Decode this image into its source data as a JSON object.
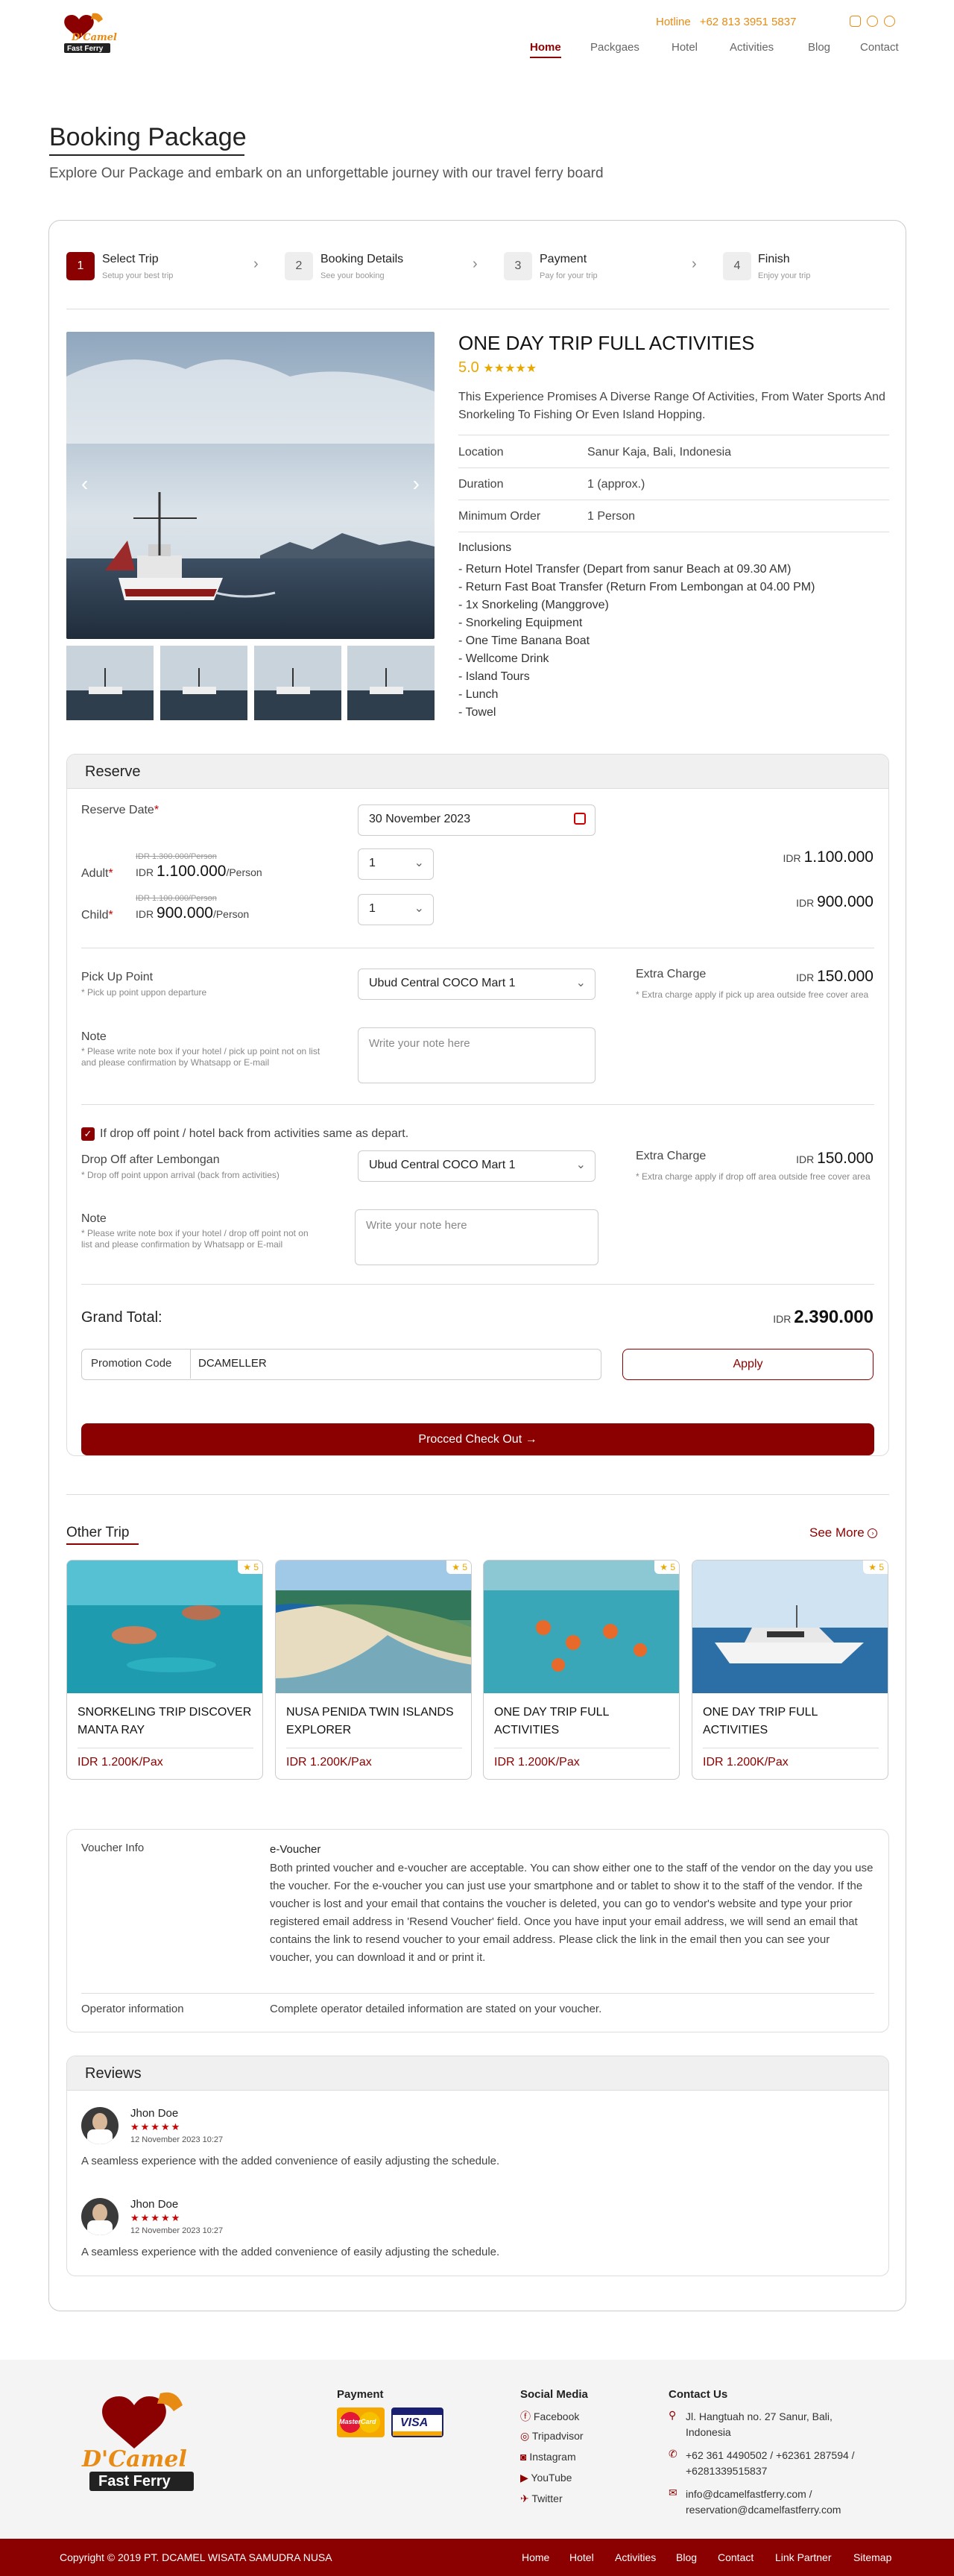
{
  "header": {
    "hotline_label": "Hotline",
    "hotline_number": "+62 813 3951 5837",
    "nav": [
      "Home",
      "Packgaes",
      "Hotel",
      "Activities",
      "Blog",
      "Contact"
    ]
  },
  "page": {
    "title": "Booking Package",
    "subtitle": "Explore Our Package and embark on an unforgettable journey with our travel ferry board"
  },
  "steps": [
    {
      "num": "1",
      "title": "Select Trip",
      "sub": "Setup your best trip"
    },
    {
      "num": "2",
      "title": "Booking Details",
      "sub": "See your booking"
    },
    {
      "num": "3",
      "title": "Payment",
      "sub": "Pay for your trip"
    },
    {
      "num": "4",
      "title": "Finish",
      "sub": "Enjoy your trip"
    }
  ],
  "product": {
    "title": "ONE DAY TRIP FULL ACTIVITIES",
    "rating": "5.0",
    "stars": "★★★★★",
    "description": "This Experience Promises A Diverse Range Of Activities, From Water Sports And Snorkeling To Fishing Or Even Island Hopping.",
    "details": [
      {
        "k": "Location",
        "v": "Sanur Kaja, Bali, Indonesia"
      },
      {
        "k": "Duration",
        "v": "1 (approx.)"
      },
      {
        "k": "Minimum Order",
        "v": "1 Person"
      }
    ],
    "inclusions_label": "Inclusions",
    "inclusions": [
      "- Return Hotel Transfer (Depart from sanur Beach at 09.30 AM)",
      "- Return Fast Boat Transfer (Return From Lembongan at 04.00 PM)",
      "- 1x Snorkeling (Manggrove)",
      "- Snorkeling Equipment",
      "- One Time Banana Boat",
      "- Wellcome Drink",
      "- Island Tours",
      "- Lunch",
      "- Towel"
    ]
  },
  "reserve": {
    "title": "Reserve",
    "date_label": "Reserve Date",
    "date_value": "30 November 2023",
    "adult_label": "Adult",
    "adult_old": "IDR 1.300.000/Person",
    "adult_cur": "IDR",
    "adult_price": "1.100.000",
    "adult_unit": "/Person",
    "adult_qty": "1",
    "adult_total_cur": "IDR",
    "adult_total": "1.100.000",
    "child_label": "Child",
    "child_old": "IDR 1.100.000/Person",
    "child_cur": "IDR",
    "child_price": "900.000",
    "child_unit": "/Person",
    "child_qty": "1",
    "child_total_cur": "IDR",
    "child_total": "900.000",
    "pickup_label": "Pick Up Point",
    "pickup_hint": "* Pick up point uppon departure",
    "pickup_value": "Ubud Central COCO Mart 1",
    "extra_label": "Extra Charge",
    "extra_cur": "IDR",
    "extra_value": "150.000",
    "extra_hint": "* Extra charge apply if pick up area outside free cover area",
    "note_label": "Note",
    "note_hint": "* Please write note box if your hotel / pick up point not on list and please confirmation by Whatsapp or E-mail",
    "note_placeholder": "Write your note here",
    "same_checkbox": "If drop off point / hotel back from activities same as depart.",
    "dropoff_label": "Drop Off after Lembongan",
    "dropoff_hint": "* Drop off point uppon arrival (back from activities)",
    "dropoff_value": "Ubud Central COCO Mart 1",
    "extra2_label": "Extra Charge",
    "extra2_cur": "IDR",
    "extra2_value": "150.000",
    "extra2_hint": "* Extra charge apply if drop off area outside free cover area",
    "note2_label": "Note",
    "note2_hint": "* Please write note box if your hotel / drop off point not on list and please confirmation by Whatsapp or E-mail",
    "note2_placeholder": "Write your note here",
    "grand_label": "Grand Total:",
    "grand_cur": "IDR",
    "grand_value": "2.390.000",
    "promo_label": "Promotion Code",
    "promo_value": "DCAMELLER",
    "apply": "Apply",
    "checkout": "Procced Check Out"
  },
  "other": {
    "title": "Other Trip",
    "see_more": "See More",
    "trips": [
      {
        "title": "SNORKELING TRIP DISCOVER MANTA RAY",
        "price": "IDR 1.200K/Pax",
        "rating": "5"
      },
      {
        "title": "NUSA PENIDA TWIN ISLANDS EXPLORER",
        "price": "IDR 1.200K/Pax",
        "rating": "5"
      },
      {
        "title": "ONE DAY TRIP FULL ACTIVITIES",
        "price": "IDR 1.200K/Pax",
        "rating": "5"
      },
      {
        "title": "ONE DAY TRIP FULL ACTIVITIES",
        "price": "IDR 1.200K/Pax",
        "rating": "5"
      }
    ]
  },
  "voucher": {
    "label": "Voucher Info",
    "title": "e-Voucher",
    "text": "Both printed voucher and e-voucher are acceptable. You can show either one to the staff of the vendor on the day you use the voucher. For the e-voucher you can just use your smartphone and or tablet to show it to the staff of the vendor. If the voucher is lost and your email that contains the voucher is deleted, you can go to vendor's website and type your prior registered email address in 'Resend Voucher' field. Once you have input your email address, we will send an email that contains the link to resend voucher to your email address. Please click the link in the email then you can see your voucher, you can download it and or print it.",
    "op_label": "Operator information",
    "op_text": "Complete operator detailed information are stated on your voucher."
  },
  "reviews": {
    "title": "Reviews",
    "items": [
      {
        "name": "Jhon Doe",
        "stars": "★★★★★",
        "date": "12 November 2023 10:27",
        "text": "A seamless experience with the added convenience of easily adjusting the schedule."
      },
      {
        "name": "Jhon Doe",
        "stars": "★★★★★",
        "date": "12 November 2023 10:27",
        "text": "A seamless experience with the added convenience of easily adjusting the schedule."
      }
    ]
  },
  "footer": {
    "logo_top": "D'Camel",
    "logo_bottom": "Fast Ferry",
    "payment_title": "Payment",
    "mastercard": "MasterCard",
    "visa": "VISA",
    "social_title": "Social Media",
    "social": [
      "Facebook",
      "Tripadvisor",
      "Instagram",
      "YouTube",
      "Twitter"
    ],
    "contact_title": "Contact Us",
    "address": "Jl. Hangtuah no. 27 Sanur, Bali, Indonesia",
    "phone": "+62 361 4490502  / +62361 287594 / +6281339515837",
    "email": "info@dcamelfastferry.com / reservation@dcamelfastferry.com",
    "copyright": "Copyright © 2019 PT. DCAMEL WISATA SAMUDRA NUSA",
    "links": [
      "Home",
      "Hotel",
      "Activities",
      "Blog",
      "Contact",
      "Link Partner",
      "Sitemap"
    ]
  },
  "colors": {
    "brand": "#8b0000",
    "accent": "#e78b15",
    "star": "#e8a800"
  }
}
